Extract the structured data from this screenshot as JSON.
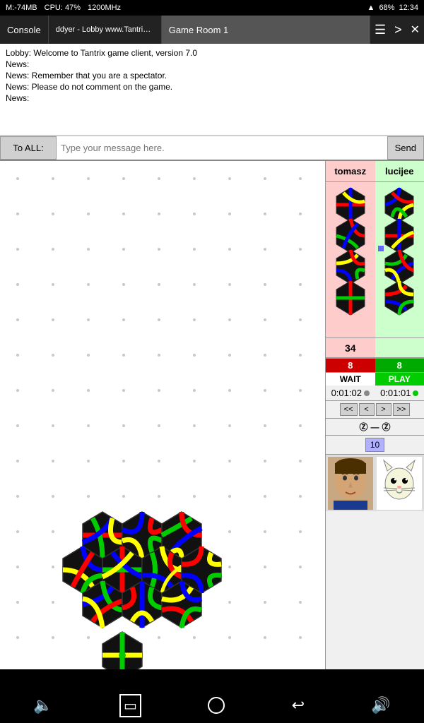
{
  "statusBar": {
    "memLabel": "M:-74MB",
    "cpuLabel": "CPU: 47%",
    "freqLabel": "1200MHz",
    "batteryPercent": "68%",
    "time": "12:34",
    "wifiIcon": "wifi-icon",
    "batteryIcon": "battery-icon"
  },
  "tabs": [
    {
      "id": "console",
      "label": "Console",
      "active": false
    },
    {
      "id": "lobby",
      "label": "ddyer - Lobby www.Tantrix.com",
      "active": false
    },
    {
      "id": "gameroom",
      "label": "Game Room 1",
      "active": true
    }
  ],
  "tabMenu": "☰",
  "tabMore": ">",
  "tabClose": "✕",
  "chat": {
    "lines": [
      "Lobby: Welcome to Tantrix game client, version 7.0",
      "News:",
      "News: Remember that you are a spectator.",
      "News: Please do not comment on the game.",
      "News:"
    ]
  },
  "messageInput": {
    "toAllLabel": "To ALL:",
    "placeholder": "Type your message here.",
    "sendLabel": "Send"
  },
  "players": [
    {
      "id": "tomasz",
      "name": "tomasz",
      "score": "34",
      "timerBadge": "8",
      "timerBadgeColor": "red",
      "status": "WAIT",
      "time": "0:01:02",
      "dotColor": "grey",
      "bgColor": "#ffcccc"
    },
    {
      "id": "lucijee",
      "name": "lucijee",
      "score": "",
      "timerBadge": "8",
      "timerBadgeColor": "green",
      "status": "PLAY",
      "time": "0:01:01",
      "dotColor": "green",
      "bgColor": "#ccffcc"
    }
  ],
  "navigation": {
    "prevPrev": "<<",
    "prev": "<",
    "next": ">",
    "nextNext": ">>",
    "moveCounter": "10",
    "zLeft": "Ⓩ",
    "arrow": "—",
    "zRight": "Ⓩ"
  },
  "bottomBar": {
    "volumeIcon": "🔈",
    "homeSquareIcon": "⬜",
    "homeCircleIcon": "⬤",
    "backIcon": "↩",
    "volumeUpIcon": "🔊"
  }
}
